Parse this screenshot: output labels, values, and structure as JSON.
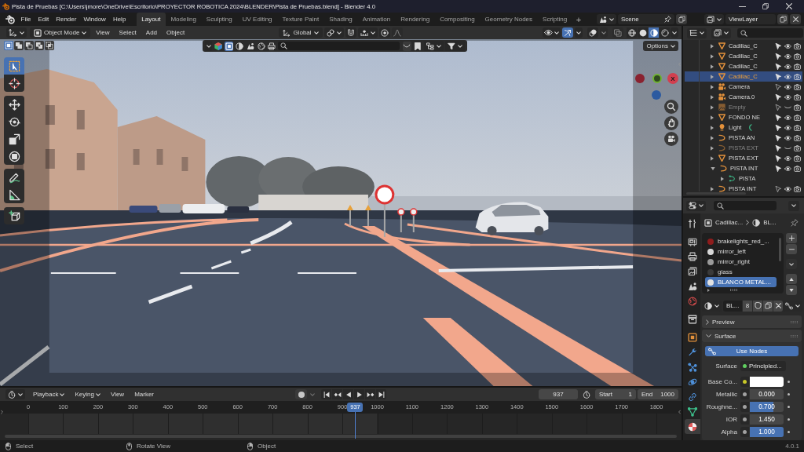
{
  "window": {
    "title": "Pista de Pruebas [C:\\Users\\jmore\\OneDrive\\Escritorio\\PROYECTOR ROBOTICA 2024\\BLENDER\\Pista de Pruebas.blend] - Blender 4.0"
  },
  "top_bar": {
    "menus": [
      "File",
      "Edit",
      "Render",
      "Window",
      "Help"
    ],
    "workspaces": [
      {
        "label": "Layout",
        "selected": true
      },
      {
        "label": "Modeling",
        "selected": false
      },
      {
        "label": "Sculpting",
        "selected": false
      },
      {
        "label": "UV Editing",
        "selected": false
      },
      {
        "label": "Texture Paint",
        "selected": false
      },
      {
        "label": "Shading",
        "selected": false
      },
      {
        "label": "Animation",
        "selected": false
      },
      {
        "label": "Rendering",
        "selected": false
      },
      {
        "label": "Compositing",
        "selected": false
      },
      {
        "label": "Geometry Nodes",
        "selected": false
      },
      {
        "label": "Scripting",
        "selected": false
      }
    ],
    "add_workspace": "+",
    "scene": "Scene",
    "view_layer": "ViewLayer"
  },
  "viewport": {
    "editor_menus": [
      "View",
      "Select",
      "Add",
      "Object"
    ],
    "mode": "Object Mode",
    "orientation": "Global",
    "snap_on": false,
    "proportional_on": false,
    "gizmos_on": true,
    "overlays_on": false,
    "xray_on": false,
    "shading": [
      {
        "kind": "wireframe",
        "selected": false
      },
      {
        "kind": "solid",
        "selected": false
      },
      {
        "kind": "material",
        "selected": true
      },
      {
        "kind": "rendered",
        "selected": false
      }
    ],
    "select_modes": [
      {
        "kind": "new",
        "selected": true
      },
      {
        "kind": "extend",
        "selected": false
      },
      {
        "kind": "subtract",
        "selected": false
      },
      {
        "kind": "invert",
        "selected": false
      },
      {
        "kind": "intersect",
        "selected": false
      }
    ],
    "filter_icons": [
      {
        "kind": "color-cube",
        "selected": false
      },
      {
        "kind": "square",
        "selected": true
      },
      {
        "kind": "half-sphere",
        "selected": false
      },
      {
        "kind": "scene",
        "selected": false
      },
      {
        "kind": "globe",
        "selected": false
      },
      {
        "kind": "printer",
        "selected": false
      }
    ],
    "options": "Options",
    "tool_groups": [
      {
        "tools": [
          {
            "kind": "select-box",
            "selected": true
          },
          {
            "kind": "cursor",
            "selected": false
          }
        ]
      },
      {
        "tools": [
          {
            "kind": "move",
            "selected": false
          },
          {
            "kind": "rotate",
            "selected": false
          },
          {
            "kind": "scale",
            "selected": false
          },
          {
            "kind": "transform",
            "selected": false
          }
        ]
      },
      {
        "tools": [
          {
            "kind": "annotate",
            "selected": false
          },
          {
            "kind": "measure",
            "selected": false
          }
        ]
      },
      {
        "tools": [
          {
            "kind": "add-cube",
            "selected": false
          }
        ]
      }
    ],
    "gizmo_label": "X"
  },
  "timeline": {
    "menus": [
      {
        "label": "Playback",
        "kind": "dropdown"
      },
      {
        "label": "Keying",
        "kind": "dropdown"
      },
      {
        "label": "View",
        "kind": "plain"
      },
      {
        "label": "Marker",
        "kind": "plain"
      }
    ],
    "auto_key": false,
    "current_frame": "937",
    "start_label": "Start",
    "start": "1",
    "end_label": "End",
    "end": "1000",
    "ticks": [
      "0",
      "100",
      "200",
      "300",
      "400",
      "500",
      "600",
      "700",
      "800",
      "900",
      "1000",
      "1100",
      "1200",
      "1300",
      "1400",
      "1500",
      "1600",
      "1700",
      "1800"
    ],
    "playhead": "937"
  },
  "outliner": {
    "rows": [
      {
        "name": "Cadillac_C",
        "kind": "mesh",
        "selected": false,
        "expanded": false,
        "selectable": true,
        "visible": true
      },
      {
        "name": "Cadillac_C",
        "kind": "mesh",
        "selected": false,
        "expanded": false,
        "selectable": true,
        "visible": true
      },
      {
        "name": "Cadillac_C",
        "kind": "mesh",
        "selected": false,
        "expanded": false,
        "selectable": true,
        "visible": true
      },
      {
        "name": "Cadillac_C",
        "kind": "mesh",
        "selected": true,
        "expanded": false,
        "selectable": true,
        "visible": true
      },
      {
        "name": "Camera",
        "kind": "camera",
        "selected": false,
        "expanded": false,
        "selectable": false,
        "visible": true
      },
      {
        "name": "Camera.0",
        "kind": "camera",
        "selected": false,
        "expanded": false,
        "selectable": true,
        "visible": true
      },
      {
        "name": "Empty",
        "kind": "empty",
        "selected": false,
        "expanded": false,
        "selectable": false,
        "visible": false
      },
      {
        "name": "FONDO NE",
        "kind": "mesh",
        "selected": false,
        "expanded": false,
        "selectable": true,
        "visible": true
      },
      {
        "name": "Light",
        "kind": "light",
        "selected": false,
        "expanded": false,
        "selectable": true,
        "visible": true,
        "inline_icons": [
          {
            "kind": "light-data"
          }
        ]
      },
      {
        "name": "PISTA AN",
        "kind": "curve",
        "selected": false,
        "expanded": false,
        "selectable": true,
        "visible": true
      },
      {
        "name": "PISTA EXT",
        "kind": "curve",
        "selected": false,
        "expanded": false,
        "selectable": true,
        "visible": false
      },
      {
        "name": "PISTA EXT",
        "kind": "mesh",
        "selected": false,
        "expanded": false,
        "selectable": true,
        "visible": true
      },
      {
        "name": "PISTA INT",
        "kind": "curve",
        "selected": false,
        "expanded": true,
        "selectable": true,
        "visible": true,
        "children": [
          {
            "name": "PISTA",
            "kind": "curve-data",
            "selected": false,
            "expanded": false
          }
        ]
      },
      {
        "name": "PISTA INT",
        "kind": "curve",
        "selected": false,
        "expanded": false,
        "selectable": false,
        "visible": true
      }
    ]
  },
  "properties": {
    "tab_groups": [
      {
        "tabs": [
          {
            "kind": "tool",
            "selected": false
          }
        ]
      },
      {
        "tabs": [
          {
            "kind": "render",
            "selected": false
          },
          {
            "kind": "output",
            "selected": false
          },
          {
            "kind": "view-layer",
            "selected": false
          },
          {
            "kind": "scene",
            "selected": false
          },
          {
            "kind": "world",
            "selected": false
          }
        ]
      },
      {
        "tabs": [
          {
            "kind": "collection",
            "selected": false
          }
        ]
      },
      {
        "tabs": [
          {
            "kind": "object",
            "selected": false
          },
          {
            "kind": "modifiers",
            "selected": false
          },
          {
            "kind": "particles",
            "selected": false
          },
          {
            "kind": "physics",
            "selected": false
          },
          {
            "kind": "constraints",
            "selected": false
          },
          {
            "kind": "data",
            "selected": false
          },
          {
            "kind": "material",
            "selected": true
          }
        ]
      }
    ],
    "breadcrumb": {
      "object": "Cadillac...",
      "material": "BL..."
    },
    "slots": [
      {
        "name": "brakelights_red_...",
        "color": "#8e1c1c",
        "selected": false
      },
      {
        "name": "mirror_left",
        "color": "#d8d8d8",
        "selected": false
      },
      {
        "name": "mirror_right",
        "color": "#9a9a9a",
        "selected": false
      },
      {
        "name": "glass",
        "color": "#3a3a3a",
        "selected": false
      },
      {
        "name": "BLANCO METAL...",
        "color": "#e2e2e2",
        "selected": true
      }
    ],
    "material": {
      "name": "BL...",
      "users": "8"
    },
    "panels": [
      {
        "title": "Preview",
        "expanded": false
      },
      {
        "title": "Surface",
        "expanded": true,
        "use_nodes": "Use Nodes",
        "inputs": [
          {
            "label": "Surface",
            "kind": "shader",
            "value": "Principled..."
          },
          {
            "label": "Base Co...",
            "kind": "color",
            "color": "#ffffff"
          },
          {
            "label": "Metallic",
            "kind": "float",
            "value": "0.000"
          },
          {
            "label": "Roughne...",
            "kind": "float",
            "value": "0.700",
            "level": 0.7
          },
          {
            "label": "IOR",
            "kind": "float",
            "value": "1.450"
          },
          {
            "label": "Alpha",
            "kind": "float",
            "value": "1.000",
            "level": 1
          }
        ]
      }
    ]
  },
  "status_bar": {
    "hints": [
      {
        "kind": "left-click",
        "label": "Select"
      },
      {
        "kind": "middle-click",
        "label": "Rotate View"
      },
      {
        "kind": "right-click",
        "label": "Object"
      }
    ],
    "version": "4.0.1"
  }
}
